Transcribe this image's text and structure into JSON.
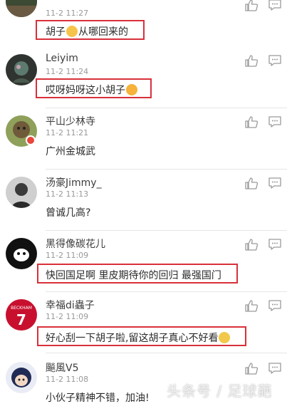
{
  "comments": [
    {
      "name": "",
      "time": "11-2 11:27",
      "text": "胡子",
      "text_tail": "从哪回来的",
      "emoji": "crying-face"
    },
    {
      "name": "Leiyim",
      "time": "11-2 11:24",
      "text": "哎呀妈呀这小胡子",
      "emoji": "laughing-face"
    },
    {
      "name": "平山少林寺",
      "time": "11-2 11:21",
      "text": "广州金城武"
    },
    {
      "name": "汤豪Jimmy_",
      "time": "11-2 11:13",
      "text": "曾诚几高?"
    },
    {
      "name": "黑得像碳花儿",
      "time": "11-2 11:09",
      "text": "快回国足啊 里皮期待你的回归 最强国门"
    },
    {
      "name": "幸福di蟲子",
      "time": "11-2 11:09",
      "text": "好心刮一下胡子啦,留这胡子真心不好看",
      "emoji": "thinking-face"
    },
    {
      "name": "飈風V5",
      "time": "11-2 11:08",
      "text": "小伙子精神不错，加油!"
    }
  ],
  "avatar_labels": {
    "jersey_name": "BECKHAM",
    "jersey_number": "7"
  },
  "watermark": "头条号 / 足球葩",
  "colors": {
    "highlight_border": "#d9303a"
  }
}
